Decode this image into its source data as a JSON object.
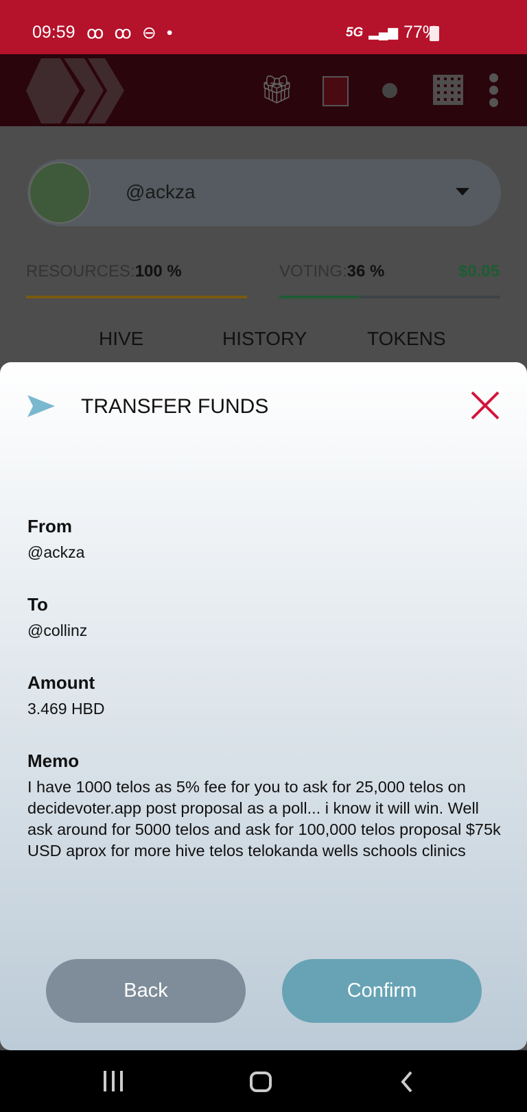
{
  "status_bar": {
    "time": "09:59",
    "left_icons": "ꝏ ꝏ ⊖ •",
    "network": "5G",
    "battery": "77%"
  },
  "header": {
    "icons": [
      "hive-logo-icon",
      "gift-icon",
      "cube-icon",
      "dot-icon",
      "qr-code-icon",
      "more-vert-icon"
    ]
  },
  "account": {
    "username": "@ackza"
  },
  "resources": {
    "label": "RESOURCES:",
    "value": "100 %",
    "fill": 1.0,
    "color": "#7a5a10"
  },
  "voting": {
    "label": "VOTING:",
    "value": "36 %",
    "fill": 0.36,
    "usd": "$0.05",
    "color": "#1e5c34"
  },
  "tabs": [
    "HIVE",
    "HISTORY",
    "TOKENS"
  ],
  "modal": {
    "title": "TRANSFER FUNDS",
    "fields": [
      {
        "label": "From",
        "value": "@ackza"
      },
      {
        "label": "To",
        "value": "@collinz"
      },
      {
        "label": "Amount",
        "value": "3.469 HBD"
      },
      {
        "label": "Memo",
        "value": "I have 1000 telos as 5% fee for you to ask for 25,000 telos on decidevoter.app post proposal as a poll... i know it will win. Well ask around for 5000 telos and ask for 100,000 telos proposal $75k USD aprox for more hive telos telokanda wells schools clinics"
      }
    ],
    "back_label": "Back",
    "confirm_label": "Confirm"
  },
  "colors": {
    "status_bar": "#b5122b",
    "close": "#d4143a",
    "send_icon": "#7ab8d0",
    "back": "#7f8c99",
    "confirm": "#67a3b5"
  }
}
